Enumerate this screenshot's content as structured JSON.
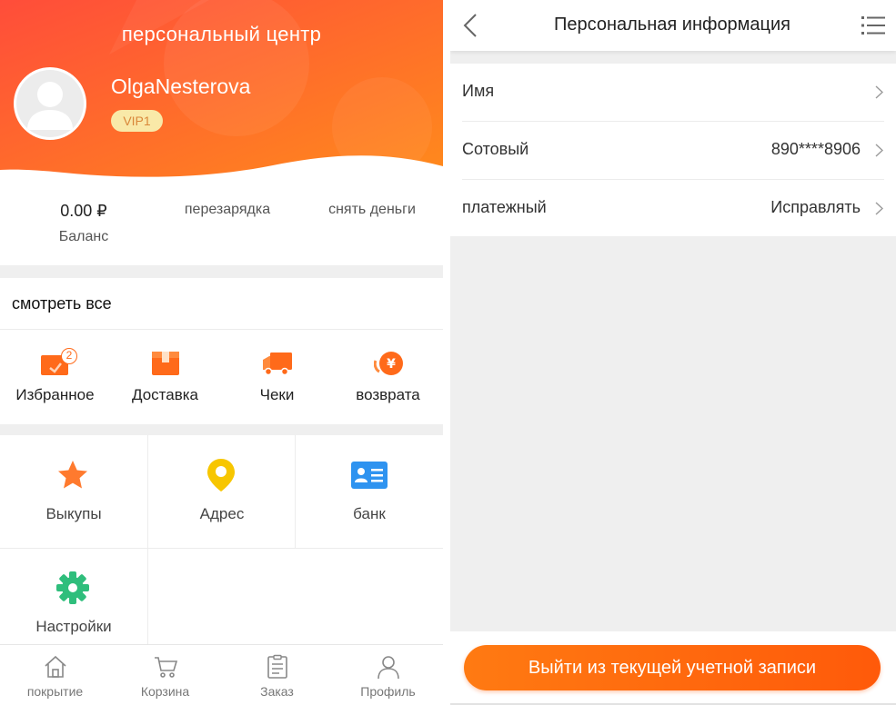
{
  "profile": {
    "header_title": "персональный центр",
    "username": "OlgaNesterova",
    "vip_label": "VIP1",
    "avatar_icon": "user-avatar-icon",
    "gradient_start": "#ff5437",
    "gradient_end": "#ff8a1c"
  },
  "balance": {
    "amount": "0.00 ₽",
    "label": "Баланс",
    "recharge_label": "перезарядка",
    "withdraw_label": "снять деньги"
  },
  "orders": {
    "view_all_label": "смотреть все",
    "items": [
      {
        "label": "Избранное",
        "icon": "favorites-icon",
        "badge": "2"
      },
      {
        "label": "Доставка",
        "icon": "delivery-box-icon"
      },
      {
        "label": "Чеки",
        "icon": "truck-icon"
      },
      {
        "label": "возврата",
        "icon": "refund-yen-icon"
      }
    ]
  },
  "services": {
    "items": [
      {
        "label": "Выкупы",
        "icon": "star-icon",
        "color": "#ff7a2e"
      },
      {
        "label": "Адрес",
        "icon": "location-pin-icon",
        "color": "#f7c600"
      },
      {
        "label": "банк",
        "icon": "bank-card-icon",
        "color": "#2e93f0"
      },
      {
        "label": "Настройки",
        "icon": "settings-gear-icon",
        "color": "#2fbe7c"
      }
    ]
  },
  "tabbar": {
    "items": [
      {
        "label": "покрытие",
        "icon": "home-icon"
      },
      {
        "label": "Корзина",
        "icon": "cart-icon"
      },
      {
        "label": "Заказ",
        "icon": "order-list-icon"
      },
      {
        "label": "Профиль",
        "icon": "profile-icon"
      }
    ]
  },
  "personal_info": {
    "title": "Персональная информация",
    "back_icon": "back-arrow-icon",
    "menu_icon": "menu-list-icon",
    "rows": [
      {
        "key": "Имя",
        "value": ""
      },
      {
        "key": "Сотовый",
        "value": "890****8906"
      },
      {
        "key": "платежный",
        "value": "Исправлять"
      }
    ],
    "logout_label": "Выйти из текущей учетной записи"
  }
}
